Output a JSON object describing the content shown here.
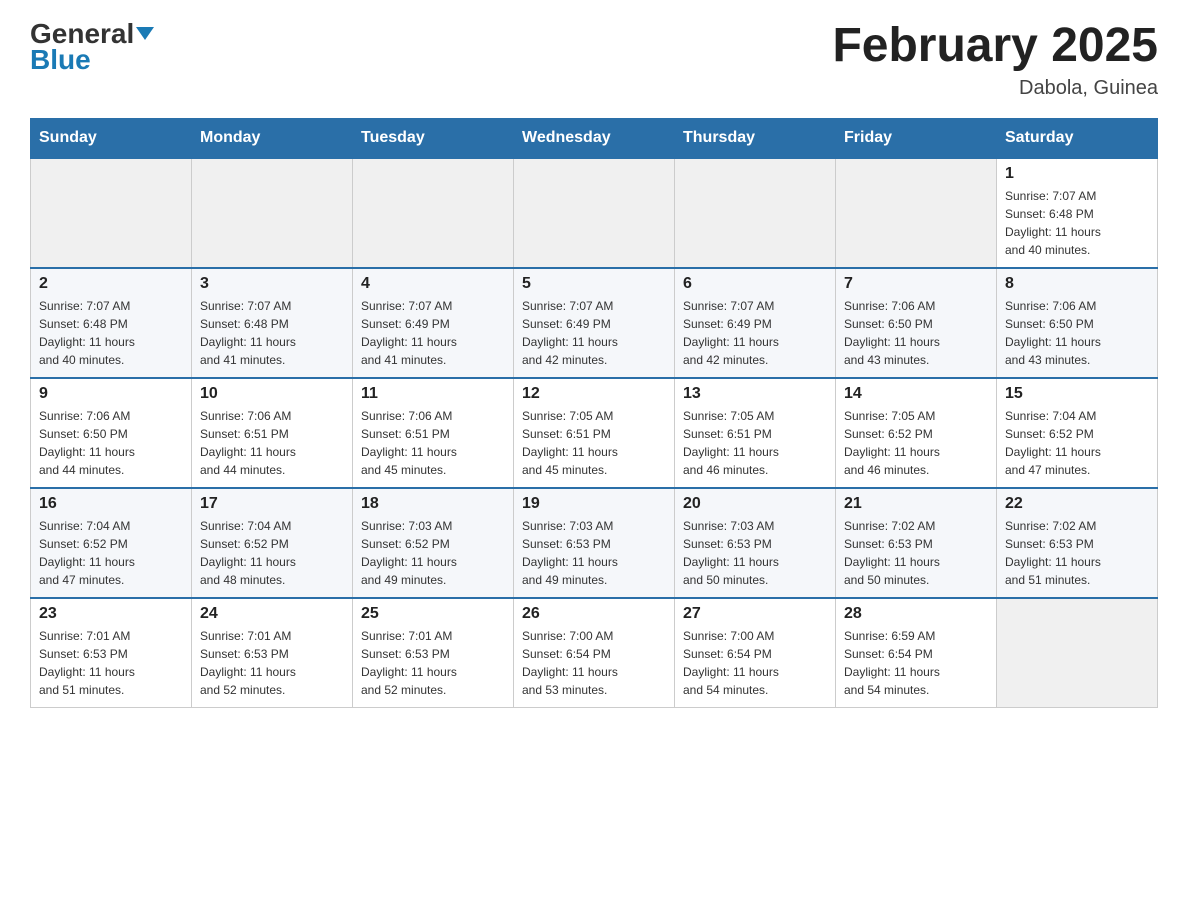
{
  "header": {
    "logo_general": "General",
    "logo_blue": "Blue",
    "month_title": "February 2025",
    "location": "Dabola, Guinea"
  },
  "days_of_week": [
    "Sunday",
    "Monday",
    "Tuesday",
    "Wednesday",
    "Thursday",
    "Friday",
    "Saturday"
  ],
  "weeks": [
    [
      {
        "day": "",
        "info": ""
      },
      {
        "day": "",
        "info": ""
      },
      {
        "day": "",
        "info": ""
      },
      {
        "day": "",
        "info": ""
      },
      {
        "day": "",
        "info": ""
      },
      {
        "day": "",
        "info": ""
      },
      {
        "day": "1",
        "info": "Sunrise: 7:07 AM\nSunset: 6:48 PM\nDaylight: 11 hours\nand 40 minutes."
      }
    ],
    [
      {
        "day": "2",
        "info": "Sunrise: 7:07 AM\nSunset: 6:48 PM\nDaylight: 11 hours\nand 40 minutes."
      },
      {
        "day": "3",
        "info": "Sunrise: 7:07 AM\nSunset: 6:48 PM\nDaylight: 11 hours\nand 41 minutes."
      },
      {
        "day": "4",
        "info": "Sunrise: 7:07 AM\nSunset: 6:49 PM\nDaylight: 11 hours\nand 41 minutes."
      },
      {
        "day": "5",
        "info": "Sunrise: 7:07 AM\nSunset: 6:49 PM\nDaylight: 11 hours\nand 42 minutes."
      },
      {
        "day": "6",
        "info": "Sunrise: 7:07 AM\nSunset: 6:49 PM\nDaylight: 11 hours\nand 42 minutes."
      },
      {
        "day": "7",
        "info": "Sunrise: 7:06 AM\nSunset: 6:50 PM\nDaylight: 11 hours\nand 43 minutes."
      },
      {
        "day": "8",
        "info": "Sunrise: 7:06 AM\nSunset: 6:50 PM\nDaylight: 11 hours\nand 43 minutes."
      }
    ],
    [
      {
        "day": "9",
        "info": "Sunrise: 7:06 AM\nSunset: 6:50 PM\nDaylight: 11 hours\nand 44 minutes."
      },
      {
        "day": "10",
        "info": "Sunrise: 7:06 AM\nSunset: 6:51 PM\nDaylight: 11 hours\nand 44 minutes."
      },
      {
        "day": "11",
        "info": "Sunrise: 7:06 AM\nSunset: 6:51 PM\nDaylight: 11 hours\nand 45 minutes."
      },
      {
        "day": "12",
        "info": "Sunrise: 7:05 AM\nSunset: 6:51 PM\nDaylight: 11 hours\nand 45 minutes."
      },
      {
        "day": "13",
        "info": "Sunrise: 7:05 AM\nSunset: 6:51 PM\nDaylight: 11 hours\nand 46 minutes."
      },
      {
        "day": "14",
        "info": "Sunrise: 7:05 AM\nSunset: 6:52 PM\nDaylight: 11 hours\nand 46 minutes."
      },
      {
        "day": "15",
        "info": "Sunrise: 7:04 AM\nSunset: 6:52 PM\nDaylight: 11 hours\nand 47 minutes."
      }
    ],
    [
      {
        "day": "16",
        "info": "Sunrise: 7:04 AM\nSunset: 6:52 PM\nDaylight: 11 hours\nand 47 minutes."
      },
      {
        "day": "17",
        "info": "Sunrise: 7:04 AM\nSunset: 6:52 PM\nDaylight: 11 hours\nand 48 minutes."
      },
      {
        "day": "18",
        "info": "Sunrise: 7:03 AM\nSunset: 6:52 PM\nDaylight: 11 hours\nand 49 minutes."
      },
      {
        "day": "19",
        "info": "Sunrise: 7:03 AM\nSunset: 6:53 PM\nDaylight: 11 hours\nand 49 minutes."
      },
      {
        "day": "20",
        "info": "Sunrise: 7:03 AM\nSunset: 6:53 PM\nDaylight: 11 hours\nand 50 minutes."
      },
      {
        "day": "21",
        "info": "Sunrise: 7:02 AM\nSunset: 6:53 PM\nDaylight: 11 hours\nand 50 minutes."
      },
      {
        "day": "22",
        "info": "Sunrise: 7:02 AM\nSunset: 6:53 PM\nDaylight: 11 hours\nand 51 minutes."
      }
    ],
    [
      {
        "day": "23",
        "info": "Sunrise: 7:01 AM\nSunset: 6:53 PM\nDaylight: 11 hours\nand 51 minutes."
      },
      {
        "day": "24",
        "info": "Sunrise: 7:01 AM\nSunset: 6:53 PM\nDaylight: 11 hours\nand 52 minutes."
      },
      {
        "day": "25",
        "info": "Sunrise: 7:01 AM\nSunset: 6:53 PM\nDaylight: 11 hours\nand 52 minutes."
      },
      {
        "day": "26",
        "info": "Sunrise: 7:00 AM\nSunset: 6:54 PM\nDaylight: 11 hours\nand 53 minutes."
      },
      {
        "day": "27",
        "info": "Sunrise: 7:00 AM\nSunset: 6:54 PM\nDaylight: 11 hours\nand 54 minutes."
      },
      {
        "day": "28",
        "info": "Sunrise: 6:59 AM\nSunset: 6:54 PM\nDaylight: 11 hours\nand 54 minutes."
      },
      {
        "day": "",
        "info": ""
      }
    ]
  ]
}
